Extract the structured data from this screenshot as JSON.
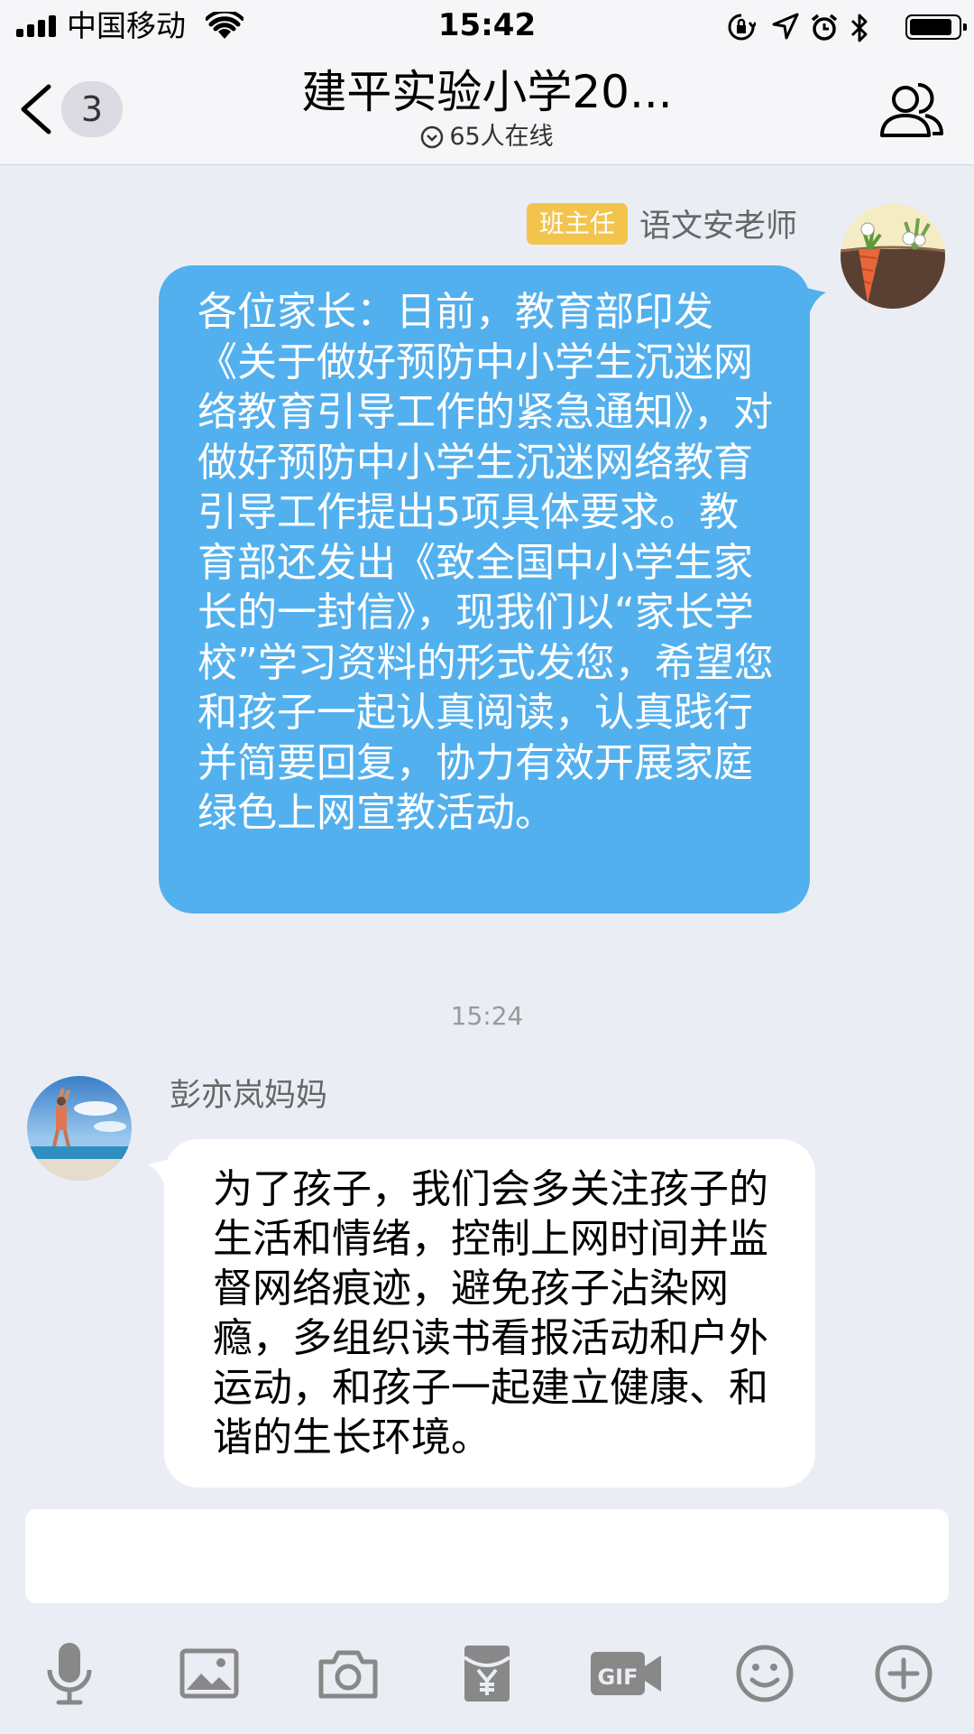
{
  "status_bar": {
    "carrier": "中国移动",
    "time": "15:42"
  },
  "nav": {
    "unread_count": "3",
    "title": "建平实验小学20...",
    "online_text": "65人在线"
  },
  "messages": [
    {
      "role_badge": "班主任",
      "sender": "语文安老师",
      "text": "各位家长：日前，教育部印发《关于做好预防中小学生沉迷网络教育引导工作的紧急通知》，对做好预防中小学生沉迷网络教育引导工作提出5项具体要求。教育部还发出《致全国中小学生家长的一封信》，现我们以“家长学校”学习资料的形式发您，希望您和孩子一起认真阅读，认真践行并简要回复，协力有效开展家庭绿色上网宣教活动。"
    },
    {
      "timestamp": "15:24",
      "sender": "彭亦岚妈妈",
      "text": "为了孩子，我们会多关注孩子的生活和情绪，控制上网时间并监督网络痕迹，避免孩子沾染网瘾，多组织读书看报活动和户外运动，和孩子一起建立健康、和谐的生长环境。"
    }
  ],
  "input": {
    "value": "",
    "placeholder": ""
  },
  "toolbar": {
    "icons": [
      "microphone-icon",
      "image-icon",
      "camera-icon",
      "red-packet-icon",
      "gif-icon",
      "emoji-icon",
      "plus-icon"
    ]
  },
  "colors": {
    "background": "#ebedf5",
    "bubble_self": "#53b0ee",
    "bubble_other": "#ffffff",
    "role_badge": "#f2c44d"
  }
}
